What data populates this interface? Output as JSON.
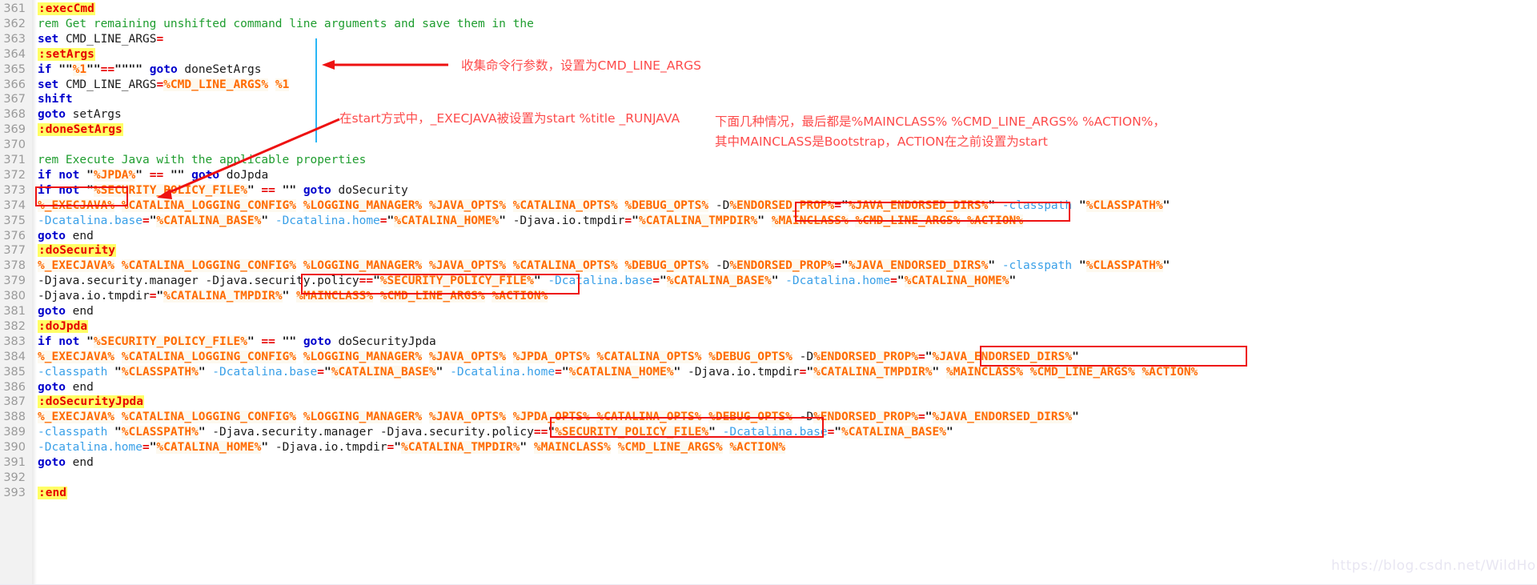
{
  "editor": {
    "language": "batch",
    "first_line": 361,
    "last_line": 393,
    "gutter_color": "#f2f2f2",
    "background": "#ffffff"
  },
  "lines": [
    {
      "n": "361",
      "text": ":execCmd"
    },
    {
      "n": "362",
      "text": "rem Get remaining unshifted command line arguments and save them in the"
    },
    {
      "n": "363",
      "text": "set CMD_LINE_ARGS="
    },
    {
      "n": "364",
      "text": ":setArgs"
    },
    {
      "n": "365",
      "text": "if \"\"%1\"\"==\"\"\"\" goto doneSetArgs"
    },
    {
      "n": "366",
      "text": "set CMD_LINE_ARGS=%CMD_LINE_ARGS% %1"
    },
    {
      "n": "367",
      "text": "shift"
    },
    {
      "n": "368",
      "text": "goto setArgs"
    },
    {
      "n": "369",
      "text": ":doneSetArgs"
    },
    {
      "n": "370",
      "text": ""
    },
    {
      "n": "371",
      "text": "rem Execute Java with the applicable properties"
    },
    {
      "n": "372",
      "text": "if not \"%JPDA%\" == \"\" goto doJpda"
    },
    {
      "n": "373",
      "text": "if not \"%SECURITY_POLICY_FILE%\" == \"\" goto doSecurity"
    },
    {
      "n": "374",
      "text": "%_EXECJAVA% %CATALINA_LOGGING_CONFIG% %LOGGING_MANAGER% %JAVA_OPTS% %CATALINA_OPTS% %DEBUG_OPTS% -D%ENDORSED_PROP%=\"%JAVA_ENDORSED_DIRS%\" -classpath \"%CLASSPATH%\""
    },
    {
      "n": "375",
      "text": "-Dcatalina.base=\"%CATALINA_BASE%\" -Dcatalina.home=\"%CATALINA_HOME%\" -Djava.io.tmpdir=\"%CATALINA_TMPDIR%\" %MAINCLASS% %CMD_LINE_ARGS% %ACTION%"
    },
    {
      "n": "376",
      "text": "goto end"
    },
    {
      "n": "377",
      "text": ":doSecurity"
    },
    {
      "n": "378",
      "text": "%_EXECJAVA% %CATALINA_LOGGING_CONFIG% %LOGGING_MANAGER% %JAVA_OPTS% %CATALINA_OPTS% %DEBUG_OPTS% -D%ENDORSED_PROP%=\"%JAVA_ENDORSED_DIRS%\" -classpath \"%CLASSPATH%\""
    },
    {
      "n": "379",
      "text": "-Djava.security.manager -Djava.security.policy==\"%SECURITY_POLICY_FILE%\" -Dcatalina.base=\"%CATALINA_BASE%\" -Dcatalina.home=\"%CATALINA_HOME%\""
    },
    {
      "n": "380",
      "text": "-Djava.io.tmpdir=\"%CATALINA_TMPDIR%\" %MAINCLASS% %CMD_LINE_ARGS% %ACTION%"
    },
    {
      "n": "381",
      "text": "goto end"
    },
    {
      "n": "382",
      "text": ":doJpda"
    },
    {
      "n": "383",
      "text": "if not \"%SECURITY_POLICY_FILE%\" == \"\" goto doSecurityJpda"
    },
    {
      "n": "384",
      "text": "%_EXECJAVA% %CATALINA_LOGGING_CONFIG% %LOGGING_MANAGER% %JAVA_OPTS% %JPDA_OPTS% %CATALINA_OPTS% %DEBUG_OPTS% -D%ENDORSED_PROP%=\"%JAVA_ENDORSED_DIRS%\""
    },
    {
      "n": "385",
      "text": "-classpath \"%CLASSPATH%\" -Dcatalina.base=\"%CATALINA_BASE%\" -Dcatalina.home=\"%CATALINA_HOME%\" -Djava.io.tmpdir=\"%CATALINA_TMPDIR%\" %MAINCLASS% %CMD_LINE_ARGS% %ACTION%"
    },
    {
      "n": "386",
      "text": "goto end"
    },
    {
      "n": "387",
      "text": ":doSecurityJpda"
    },
    {
      "n": "388",
      "text": "%_EXECJAVA% %CATALINA_LOGGING_CONFIG% %LOGGING_MANAGER% %JAVA_OPTS% %JPDA_OPTS% %CATALINA_OPTS% %DEBUG_OPTS% -D%ENDORSED_PROP%=\"%JAVA_ENDORSED_DIRS%\""
    },
    {
      "n": "389",
      "text": "-classpath \"%CLASSPATH%\" -Djava.security.manager -Djava.security.policy==\"%SECURITY_POLICY_FILE%\" -Dcatalina.base=\"%CATALINA_BASE%\""
    },
    {
      "n": "390",
      "text": "-Dcatalina.home=\"%CATALINA_HOME%\" -Djava.io.tmpdir=\"%CATALINA_TMPDIR%\" %MAINCLASS% %CMD_LINE_ARGS% %ACTION%"
    },
    {
      "n": "391",
      "text": "goto end"
    },
    {
      "n": "392",
      "text": ""
    },
    {
      "n": "393",
      "text": ":end"
    }
  ],
  "annotations": {
    "color": "#fd4b4b",
    "collect_args": "收集命令行参数，设置为CMD_LINE_ARGS",
    "execjava_start": "在start方式中，_EXECJAVA被设置为start %title _RUNJAVA",
    "mainclass_note_line1": "下面几种情况，最后都是%MAINCLASS% %CMD_LINE_ARGS% %ACTION%，",
    "mainclass_note_line2": "其中MAINCLASS是Bootstrap，ACTION在之前设置为start"
  },
  "highlight_boxes": [
    {
      "label": "execjava-box-374",
      "target": "%_EXECJAVA%"
    },
    {
      "label": "mainclass-box-375",
      "target": "%MAINCLASS% %CMD_LINE_ARGS% %ACTION%"
    },
    {
      "label": "mainclass-box-380",
      "target": "%MAINCLASS% %CMD_LINE_ARGS% %ACTION%"
    },
    {
      "label": "mainclass-box-385",
      "target": "%MAINCLASS% %CMD_LINE_ARGS% %ACTION%"
    },
    {
      "label": "mainclass-box-390",
      "target": "%MAINCLASS% %CMD_LINE_ARGS% %ACTION%"
    }
  ],
  "watermark": "https://blog.csdn.net/WildHorse"
}
